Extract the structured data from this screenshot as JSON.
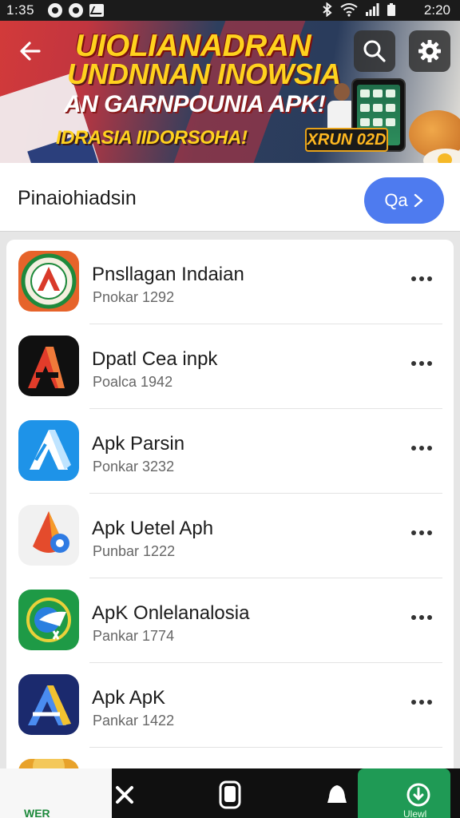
{
  "status_bar": {
    "time_left": "1:35",
    "time_right": "2:20"
  },
  "banner": {
    "line1": "UIOLIANADRAN",
    "line2": "UNDNNAN INOWSIA",
    "line3": "AN GARNPOUNIA APK!",
    "line4": "IDRASIA IIDORSOHA!",
    "badge": "XRUN 02D"
  },
  "toolbar": {
    "back_icon": "back-arrow-icon",
    "search_icon": "search-icon",
    "settings_icon": "gear-icon"
  },
  "section": {
    "title": "Pinaiohiadsin",
    "button_label": "Qa"
  },
  "apps": [
    {
      "name": "Pnsllagan Indaian",
      "sub": "Pnokar 1292"
    },
    {
      "name": "Dpatl Cea inpk",
      "sub": "Poalca 1942"
    },
    {
      "name": "Apk Parsin",
      "sub": "Ponkar 3232"
    },
    {
      "name": "Apk Uetel Aph",
      "sub": "Punbar 1222"
    },
    {
      "name": "ApK Onlelanalosia",
      "sub": "Pankar 1774"
    },
    {
      "name": "Apk ApK",
      "sub": "Pankar 1422"
    }
  ],
  "bottom_nav": {
    "left_label": "WER",
    "active_label": "Ulewl"
  },
  "colors": {
    "accent": "#4e7bef",
    "active_tab": "#1f9a55",
    "banner_yellow": "#ffd21e"
  }
}
